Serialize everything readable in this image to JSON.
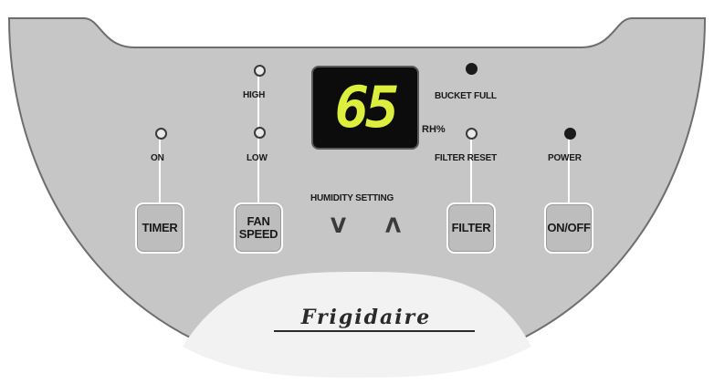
{
  "display": {
    "value": "65",
    "unit": "RH%"
  },
  "indicators": {
    "timer_on": "ON",
    "fan_high": "HIGH",
    "fan_low": "LOW",
    "bucket_full": "BUCKET FULL",
    "filter_reset": "FILTER RESET",
    "power": "POWER"
  },
  "buttons": {
    "timer": "TIMER",
    "fan_speed_line1": "FAN",
    "fan_speed_line2": "SPEED",
    "filter": "FILTER",
    "on_off": "ON/OFF"
  },
  "humidity": {
    "label": "HUMIDITY SETTING",
    "down": "V",
    "up": "Λ"
  },
  "brand": {
    "logo": "Frigidaire"
  },
  "colors": {
    "panel": "#c6c6c6",
    "panel_outline": "#6e6e6e",
    "display_bg": "#0c0c0c",
    "display_digits": "#dcef3c",
    "button_border": "#ffffff"
  },
  "icons": {
    "led_indicator": "led-dot-icon",
    "down_arrow": "humidity-down-icon",
    "up_arrow": "humidity-up-icon"
  }
}
